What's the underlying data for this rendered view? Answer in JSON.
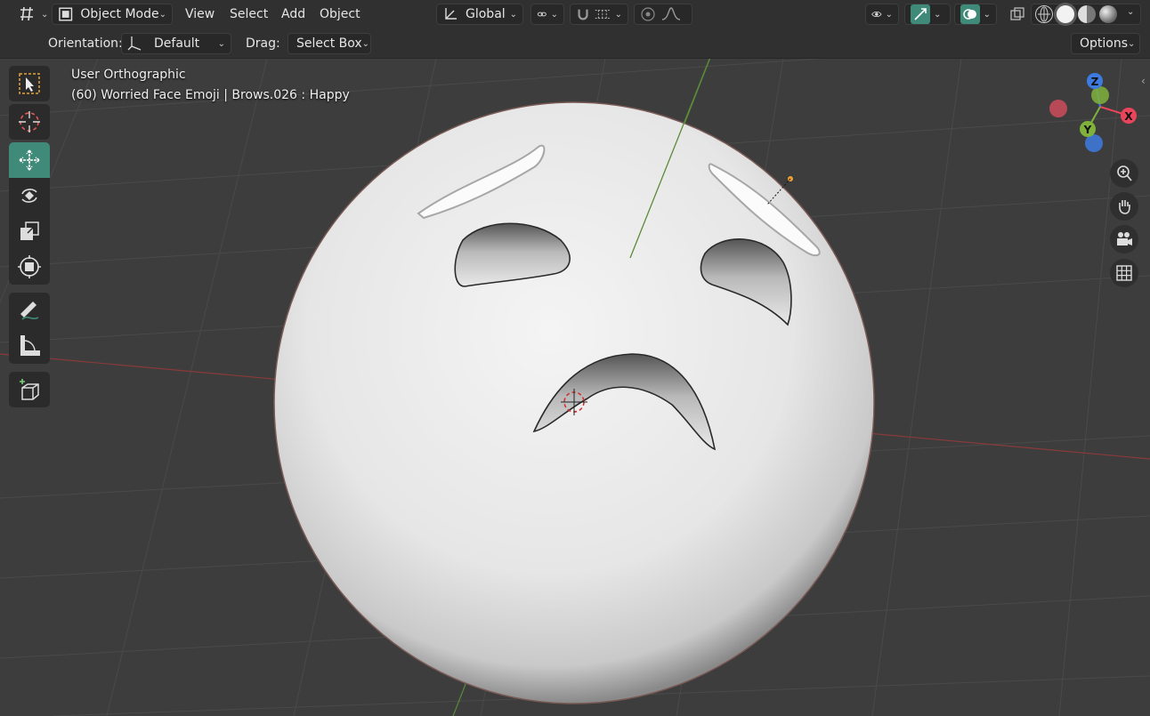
{
  "header": {
    "mode_label": "Object Mode",
    "menus": [
      "View",
      "Select",
      "Add",
      "Object"
    ],
    "transform_orientation": "Global"
  },
  "tool_settings": {
    "orientation_label": "Orientation:",
    "orientation_value": "Default",
    "drag_label": "Drag:",
    "drag_value": "Select Box",
    "options_label": "Options"
  },
  "viewport": {
    "view_name": "User Orthographic",
    "object_info": "(60) Worried Face Emoji | Brows.026 : Happy"
  },
  "gizmo": {
    "x_label": "X",
    "y_label": "Y",
    "z_label": "Z"
  },
  "toolbar": {
    "tools": [
      "select-box-tool",
      "cursor-tool",
      "move-tool",
      "rotate-tool",
      "scale-tool",
      "transform-tool",
      "annotate-tool",
      "measure-tool",
      "add-cube-tool"
    ],
    "active_tool": "move-tool"
  },
  "colors": {
    "accent": "#3f8a78",
    "x_axis": "#e8455a",
    "y_axis": "#7fb13b",
    "z_axis": "#3d7be0",
    "header_bg": "#303030",
    "viewport_bg": "#3d3d3d"
  }
}
